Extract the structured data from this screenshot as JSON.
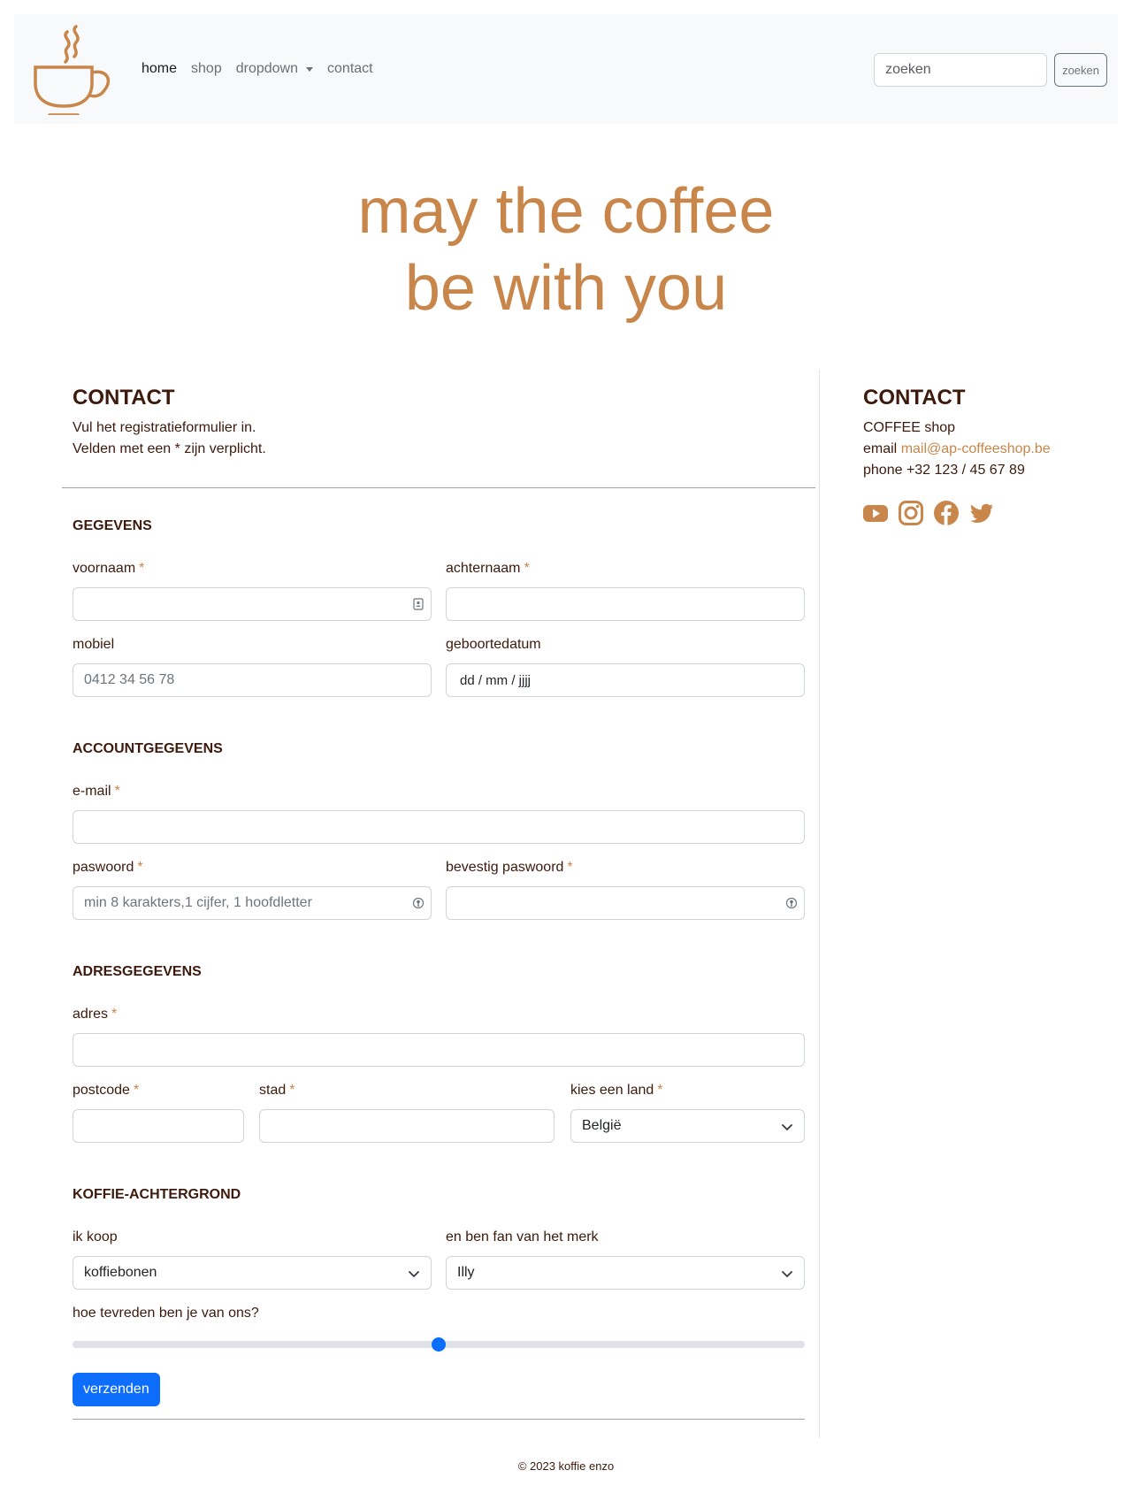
{
  "navbar": {
    "logo_icon": "coffee-cup-icon",
    "links": [
      {
        "label": "home",
        "active": true
      },
      {
        "label": "shop",
        "active": false
      },
      {
        "label": "dropdown",
        "active": false
      },
      {
        "label": "contact",
        "active": false
      }
    ],
    "search_placeholder": "zoeken",
    "search_button": "zoeken"
  },
  "hero": {
    "line1": "may the coffee",
    "line2": "be with you"
  },
  "form": {
    "title": "CONTACT",
    "intro_line1": "Vul het registratieformulier in.",
    "intro_line2": "Velden met een * zijn verplicht.",
    "sections": {
      "gegevens": "GEGEVENS",
      "account": "ACCOUNTGEGEVENS",
      "adres": "ADRESGEGEVENS",
      "koffie": "KOFFIE-ACHTERGROND"
    },
    "fields": {
      "voornaam": "voornaam",
      "achternaam": "achternaam",
      "mobiel": "mobiel",
      "mobiel_placeholder": "0412 34 56 78",
      "geboortedatum": "geboortedatum",
      "geboortedatum_value": "dd / mm / jjjj",
      "email": "e-mail",
      "paswoord": "paswoord",
      "paswoord_placeholder": "min 8 karakters,1 cijfer, 1 hoofdletter",
      "bevestig": "bevestig paswoord",
      "adres": "adres",
      "postcode": "postcode",
      "stad": "stad",
      "land": "kies een land",
      "land_value": "België",
      "koop": "ik koop",
      "koop_value": "koffiebonen",
      "merk": "en ben fan van het merk",
      "merk_value": "Illy",
      "tevreden": "hoe tevreden ben je van ons?"
    },
    "required_mark": "*",
    "satisfaction": 0.5,
    "submit": "verzenden"
  },
  "contact": {
    "title": "CONTACT",
    "company": "COFFEE shop",
    "email_label": "email",
    "email": "mail@ap-coffeeshop.be",
    "phone": "phone +32 123 / 45 67 89",
    "socials": [
      "youtube-icon",
      "instagram-icon",
      "facebook-icon",
      "twitter-icon"
    ],
    "accent_color": "#c8864a"
  },
  "footer": {
    "text": "© 2023 koffie enzo"
  }
}
